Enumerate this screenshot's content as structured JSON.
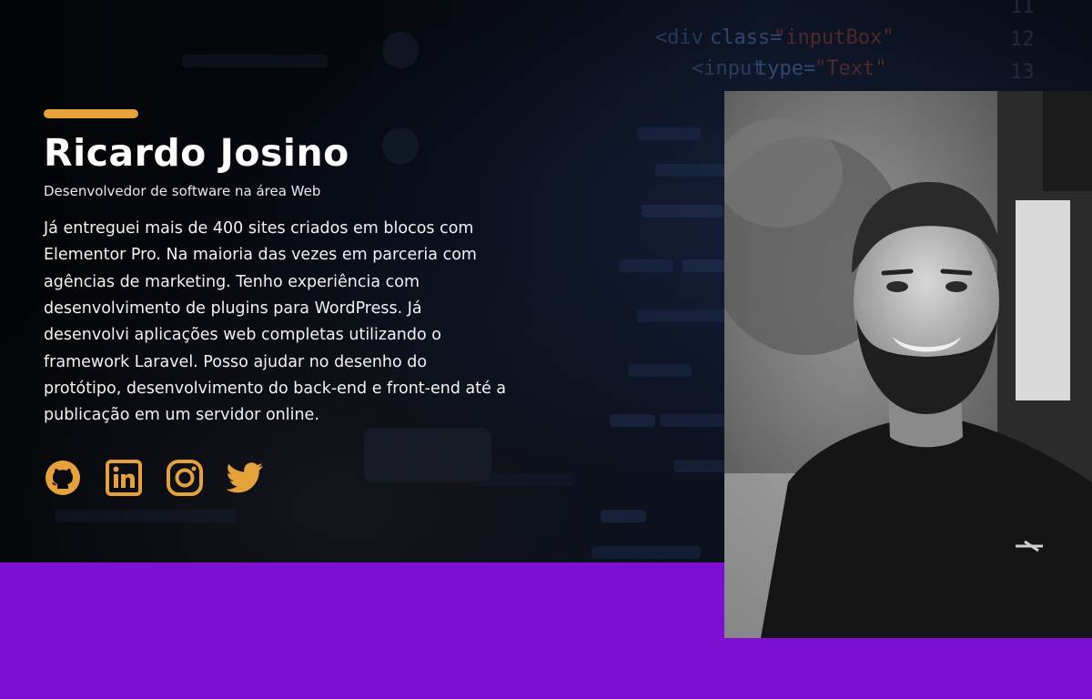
{
  "profile": {
    "name": "Ricardo Josino",
    "role": "Desenvolvedor de software na área Web",
    "bio": "Já entreguei mais de 400 sites criados em blocos com Elementor Pro. Na maioria das vezes em parceria com agências de marketing. Tenho experiência com desenvolvimento de plugins para WordPress. Já desenvolvi aplicações web completas utilizando o framework Laravel. Posso ajudar no desenho do protótipo, desenvolvimento do back-end e front-end até a publicação em um servidor online."
  },
  "socials": [
    {
      "icon": "github-icon",
      "label": "GitHub"
    },
    {
      "icon": "linkedin-icon",
      "label": "LinkedIn"
    },
    {
      "icon": "instagram-icon",
      "label": "Instagram"
    },
    {
      "icon": "twitter-icon",
      "label": "Twitter"
    }
  ],
  "photo": {
    "alt": "Ricardo Josino"
  },
  "colors": {
    "accent": "#e6a23a",
    "purple_band": "#7d10d1",
    "background": "#05070c"
  }
}
